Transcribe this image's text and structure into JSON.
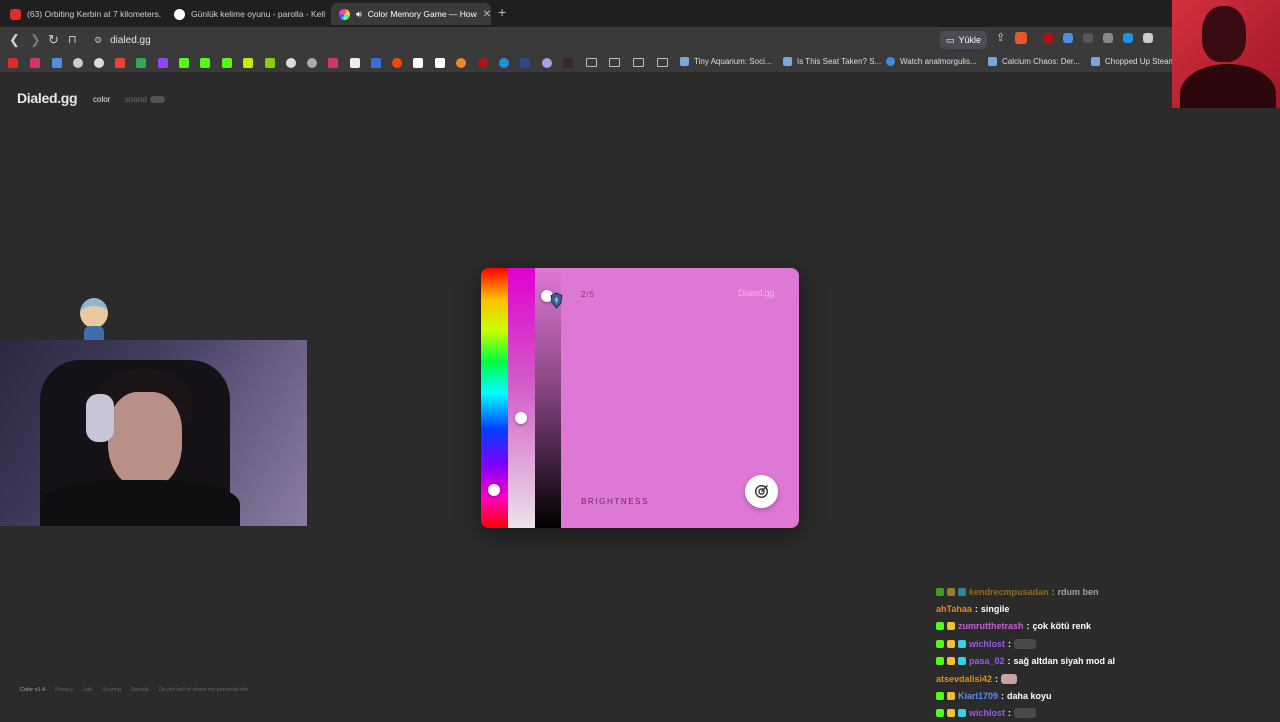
{
  "browser": {
    "tabs": [
      {
        "title": "(63) Orbiting Kerbin at 7 kilometers.",
        "favicon_color": "#e02b2b",
        "active": false
      },
      {
        "title": "Günlük kelime oyunu - parolla - Keli",
        "favicon_color": "#ffffff",
        "active": false
      },
      {
        "title": "Color Memory Game — How",
        "favicon_color": "#f4a261",
        "active": true
      }
    ],
    "new_tab_label": "+",
    "url": "dialed.gg",
    "upload_label": "Yükle",
    "bookmarks": [
      "Tiny Aquarium: Soci...",
      "Is This Seat Taken? S...",
      "Watch analmorgulis...",
      "Calcium Chaos: Der...",
      "Chopped Up Steam"
    ]
  },
  "site": {
    "logo": "Dialed.gg",
    "nav_color": "color",
    "nav_sound": "sound",
    "accent_color": "#de78d5"
  },
  "game": {
    "round": "2/5",
    "brand": "Dialed.gg",
    "slider_label": "BRIGHTNESS",
    "hue_level": 0.87,
    "saturation_level": 0.58,
    "brightness_level": 0.09
  },
  "footer": {
    "version": "Color v1.4",
    "links": [
      "Privacy",
      "Lab",
      "Scoring",
      "Socials",
      "Do not sell or share my personal info"
    ]
  },
  "chat": [
    {
      "user": "kendrecmpusadan",
      "message": "rdum ben",
      "color": "#d4a01c",
      "emote": false
    },
    {
      "user": "ahTahaa",
      "message": "singile",
      "color": "#e08a1e",
      "emote": false
    },
    {
      "user": "zumrutthetrash",
      "message": "çok kötü renk",
      "color": "#c95ad8",
      "emote": false
    },
    {
      "user": "wichlost",
      "message": "",
      "color": "#9b59f0",
      "emote": true
    },
    {
      "user": "pasa_02",
      "message": "sağ altdan siyah mod al",
      "color": "#9b59f0",
      "emote": false
    },
    {
      "user": "atsevdalisi42",
      "message": "",
      "color": "#e08a1e",
      "emote": true
    },
    {
      "user": "Kiari1709",
      "message": "daha koyu",
      "color": "#5b8ef0",
      "emote": false
    },
    {
      "user": "wichlost",
      "message": "",
      "color": "#9b59f0",
      "emote": true
    }
  ]
}
